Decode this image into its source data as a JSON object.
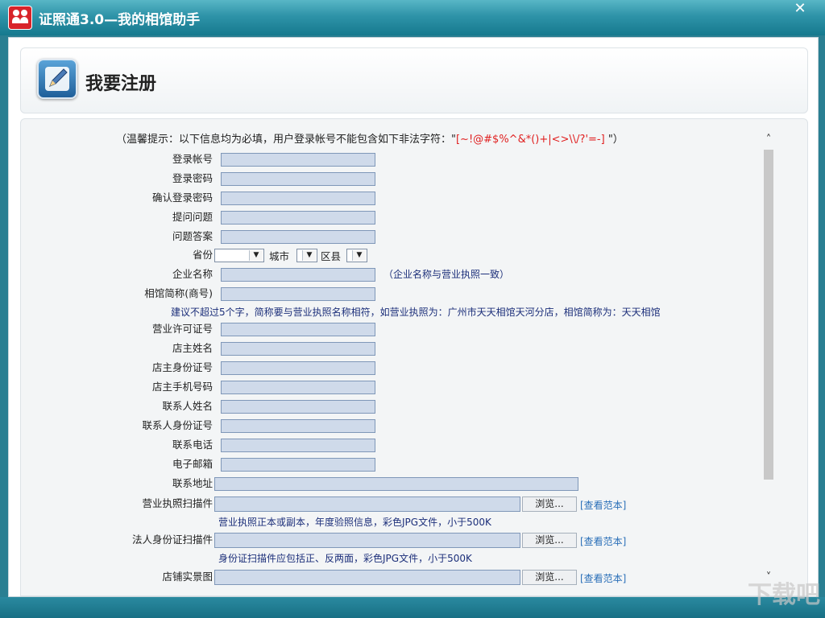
{
  "window": {
    "title": "证照通3.0—我的相馆助手",
    "close_label": "✕"
  },
  "header": {
    "title": "我要注册"
  },
  "notice": {
    "prefix": "（温馨提示：以下信息均为必填，用户登录帐号不能包含如下非法字符：\"",
    "chars": "[~!@#$%^&*()+|<>\\\\/?'=-]",
    "suffix": " \"）"
  },
  "fields": {
    "login_account": "登录帐号",
    "login_password": "登录密码",
    "confirm_password": "确认登录密码",
    "question": "提问问题",
    "answer": "问题答案",
    "province": "省份",
    "city": "城市",
    "district": "区县",
    "company_name": "企业名称",
    "company_hint": "（企业名称与营业执照一致）",
    "studio_short": "相馆简称(商号)",
    "studio_hint": "建议不超过5个字，简称要与营业执照名称相符，如营业执照为：广州市天天相馆天河分店，相馆简称为：天天相馆",
    "license_no": "营业许可证号",
    "owner_name": "店主姓名",
    "owner_id": "店主身份证号",
    "owner_mobile": "店主手机号码",
    "contact_name": "联系人姓名",
    "contact_id": "联系人身份证号",
    "contact_phone": "联系电话",
    "email": "电子邮箱",
    "address": "联系地址",
    "license_scan": "营业执照扫描件",
    "license_scan_hint": "营业执照正本或副本，年度验照信息，彩色JPG文件，小于500K",
    "id_scan": "法人身份证扫描件",
    "id_scan_hint": "身份证扫描件应包括正、反两面，彩色JPG文件，小于500K",
    "shop_photo": "店铺实景图"
  },
  "buttons": {
    "browse": "浏览...",
    "view_sample": "[查看范本]"
  },
  "watermark": "下载吧"
}
